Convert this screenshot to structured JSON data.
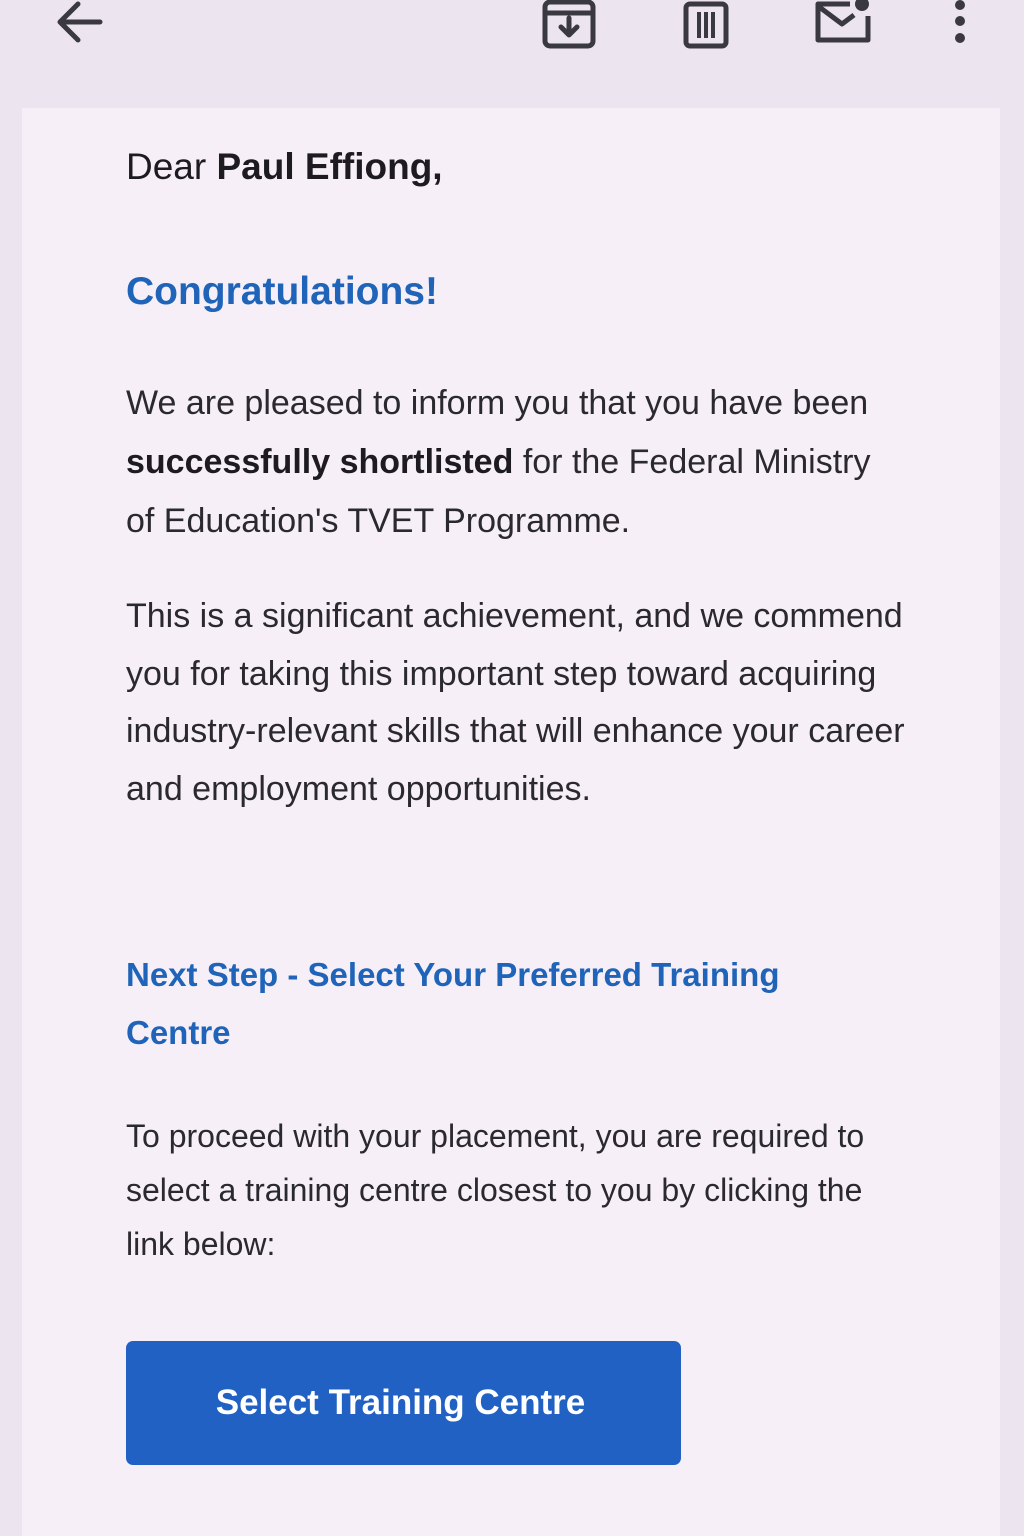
{
  "toolbar": {
    "icons": [
      "back-arrow-icon",
      "archive-icon",
      "delete-icon",
      "mark-unread-icon",
      "more-vert-icon"
    ]
  },
  "email": {
    "greeting_prefix": "Dear ",
    "recipient_name": "Paul Effiong,",
    "congrats": "Congratulations!",
    "p1_before": "We are pleased to inform you that you have been ",
    "p1_bold": "successfully shortlisted",
    "p1_after": " for the Federal Ministry of Education's TVET Programme.",
    "p2": "This is a significant achievement, and we commend you for taking this important step toward acquiring industry-relevant skills that will enhance your career and employment opportunities.",
    "next_step_heading": "Next Step - Select Your Preferred Training Centre",
    "p3": "To proceed with your placement, you are required to select a training centre closest to you by clicking the link below:",
    "cta_label": "Select Training Centre"
  },
  "colors": {
    "accent": "#1f64b8",
    "button": "#2261c4",
    "background": "#ece4ee",
    "card": "#f6eff7"
  }
}
